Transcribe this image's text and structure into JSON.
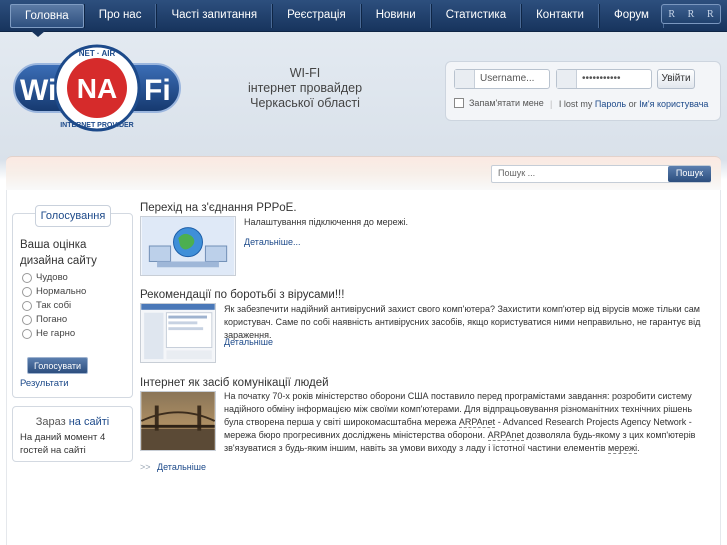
{
  "nav": {
    "items": [
      "Головна",
      "Про нас",
      "Часті запитання",
      "Реєстрація",
      "Новини",
      "Статистика",
      "Контакти",
      "Форум"
    ],
    "font_controls": [
      "R",
      "R",
      "R"
    ]
  },
  "logo": {
    "top_text": "NET · AIR",
    "left": "Wi",
    "right": "Fi",
    "center": "NA",
    "bottom_text": "INTERNET PROVIDER"
  },
  "slogan": {
    "line1": "WI-FI",
    "line2": "інтернет провайдер",
    "line3": "Черкаської області"
  },
  "login": {
    "username_placeholder": "Username...",
    "password_value": "•••••••••••",
    "submit": "Увійти",
    "remember": "Запам'ятати мене",
    "lost_prefix": "I lost my",
    "password_link": "Пароль",
    "or": "or",
    "username_link": "Ім'я користувача"
  },
  "search": {
    "placeholder": "Пошук ...",
    "button": "Пошук"
  },
  "poll": {
    "tab": "Голосування",
    "question": "Ваша оцінка дизайна сайту",
    "options": [
      "Чудово",
      "Нормально",
      "Так собі",
      "Погано",
      "Не гарно"
    ],
    "vote": "Голосувати",
    "results": "Результати"
  },
  "online": {
    "title_a": "Зараз",
    "title_b": "на сайті",
    "text": "На даний момент 4 гостей на сайті"
  },
  "articles": [
    {
      "title": "Перехід на з'єднання PPPoE.",
      "text": "Налаштування підключення до мережі.",
      "more": "Детальніше..."
    },
    {
      "title": "Рекомендації по боротьбі з вірусами!!!",
      "text": "Як забезпечити надійний антивірусний захист свого комп'ютера? Захистити комп'ютер від вірусів може тільки сам користувач. Саме по собі наявність антивірусних засобів, якщо користуватися ними неправильно, не гарантує від зараження.",
      "more": "Детальніше"
    },
    {
      "title": "Інтернет як засіб комунікації людей",
      "text_a": "На початку 70-х років міністерство оборони США поставило перед програмістами завдання: розробити систему надійного обміну інформацією між своїми комп'ютерами. Для відпрацьовування різноманітних технічних рішень була створена перша у світі широкомасштабна мережа ",
      "link1": "ARPAnet",
      "text_b": " - Advanced Research Projects Agency Network - мережа бюро прогресивних досліджень міністерства оборони. ",
      "link2": "ARPAnet",
      "text_c": " дозволяла будь-якому з цих комп'ютерів зв'язуватися з будь-яким іншим, навіть за умови виходу з ладу і їстотної частини елементів ",
      "link3": "мережі",
      "text_d": ".",
      "more_prefix": ">>",
      "more": "Детальніше"
    }
  ],
  "colors": {
    "nav": "#1f3d68",
    "link": "#1d4a8a",
    "button": "#2c4e7e"
  }
}
